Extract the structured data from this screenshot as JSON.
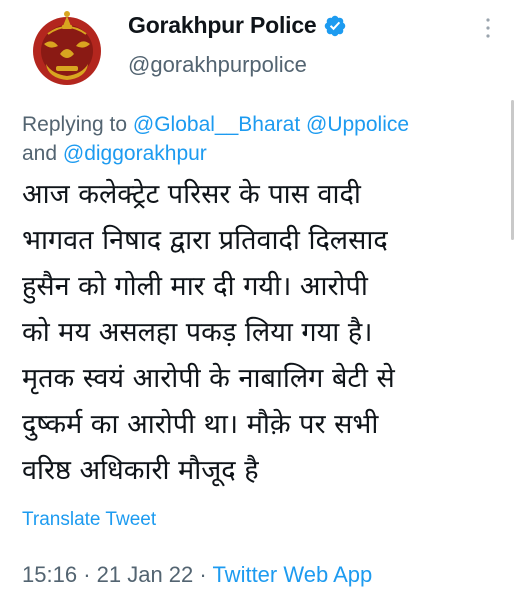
{
  "colors": {
    "link": "#1d9bf0",
    "secondary_text": "#536471",
    "primary_text": "#0f1419",
    "verified_badge": "#1d9bf0"
  },
  "author": {
    "display_name": "Gorakhpur Police",
    "handle": "@gorakhpurpolice",
    "verified": true,
    "avatar_icon": "up-police-emblem-icon"
  },
  "header": {
    "more_icon": "more-vertical-icon"
  },
  "reply": {
    "prefix": "Replying to",
    "mention_1": "@Global__Bharat",
    "mention_2": "@Uppolice",
    "conjunction": "and",
    "mention_3": "@diggorakhpur"
  },
  "tweet": {
    "lines": [
      "आज कलेक्ट्रेट परिसर के पास वादी",
      "भागवत निषाद द्वारा प्रतिवादी दिलसाद",
      "हुसैन को गोली मार दी गयी। आरोपी",
      "को मय असलहा पकड़ लिया गया है।",
      "मृतक स्वयं आरोपी के नाबालिग बेटी से",
      "दुष्कर्म का आरोपी था। मौक़े पर सभी",
      "वरिष्ठ अधिकारी मौजूद है"
    ],
    "translate_label": "Translate Tweet"
  },
  "meta": {
    "time": "15:16",
    "separator": "·",
    "date": "21 Jan 22",
    "source": "Twitter Web App"
  }
}
